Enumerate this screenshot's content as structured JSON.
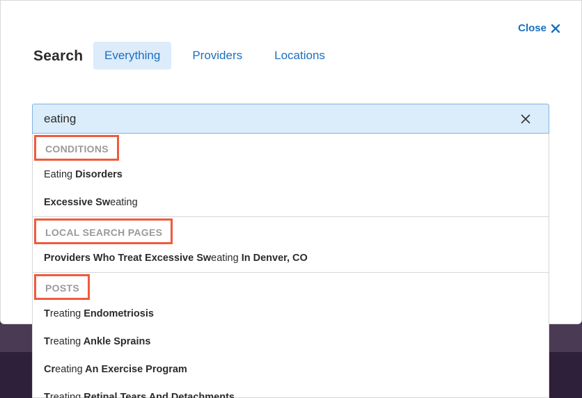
{
  "modal": {
    "close_label": "Close",
    "search_label": "Search",
    "tabs": [
      {
        "label": "Everything"
      },
      {
        "label": "Providers"
      },
      {
        "label": "Locations"
      }
    ],
    "search_value": "eating"
  },
  "sections": [
    {
      "header": "CONDITIONS",
      "items": [
        {
          "parts": [
            {
              "t": "Eating ",
              "b": false
            },
            {
              "t": "Disorders",
              "b": true
            }
          ]
        },
        {
          "parts": [
            {
              "t": "Excessive Sw",
              "b": true
            },
            {
              "t": "eating",
              "b": false
            }
          ]
        }
      ]
    },
    {
      "header": "LOCAL SEARCH PAGES",
      "items": [
        {
          "parts": [
            {
              "t": "Providers Who Treat Excessive Sw",
              "b": true
            },
            {
              "t": "eating",
              "b": false
            },
            {
              "t": " In Denver, CO",
              "b": true
            }
          ]
        }
      ]
    },
    {
      "header": "POSTS",
      "items": [
        {
          "parts": [
            {
              "t": "T",
              "b": true
            },
            {
              "t": "reating",
              "b": false
            },
            {
              "t": " Endometriosis",
              "b": true
            }
          ]
        },
        {
          "parts": [
            {
              "t": "T",
              "b": true
            },
            {
              "t": "reating",
              "b": false
            },
            {
              "t": " Ankle Sprains",
              "b": true
            }
          ]
        },
        {
          "parts": [
            {
              "t": "Cr",
              "b": true
            },
            {
              "t": "eating",
              "b": false
            },
            {
              "t": " An Exercise Program",
              "b": true
            }
          ]
        },
        {
          "parts": [
            {
              "t": "T",
              "b": true
            },
            {
              "t": "reating",
              "b": false
            },
            {
              "t": " Retinal Tears And Detachments",
              "b": true
            }
          ]
        }
      ]
    }
  ]
}
